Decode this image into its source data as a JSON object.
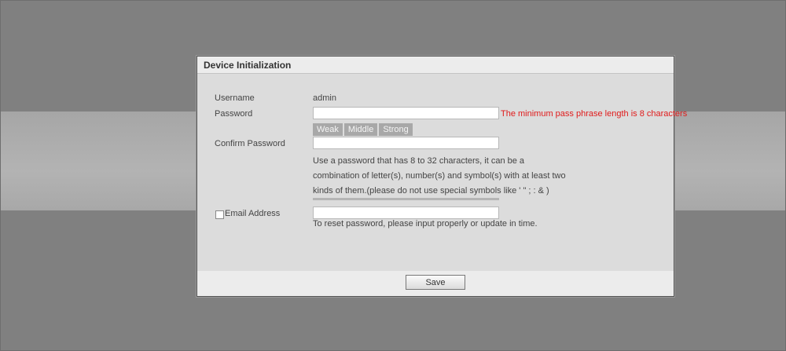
{
  "dialog": {
    "title": "Device Initialization"
  },
  "form": {
    "username_label": "Username",
    "username_value": "admin",
    "password_label": "Password",
    "password_value": "",
    "password_error": "The minimum pass phrase length is 8 characters",
    "strength_levels": [
      "Weak",
      "Middle",
      "Strong"
    ],
    "confirm_label": "Confirm Password",
    "confirm_value": "",
    "password_hint": "Use a password that has 8 to 32 characters, it can be a combination of letter(s), number(s) and symbol(s) with at least two kinds of them.(please do not use special symbols like ' \" ; : & )",
    "email_label": "Email Address",
    "email_checked": false,
    "email_value": "",
    "email_hint": "To reset password, please input properly or update in time."
  },
  "footer": {
    "save_label": "Save"
  },
  "colors": {
    "error": "#e01b1b",
    "backdrop": "#808080",
    "dialog_bg": "#dcdcdc",
    "strength_inactive": "#a8a8a8"
  }
}
